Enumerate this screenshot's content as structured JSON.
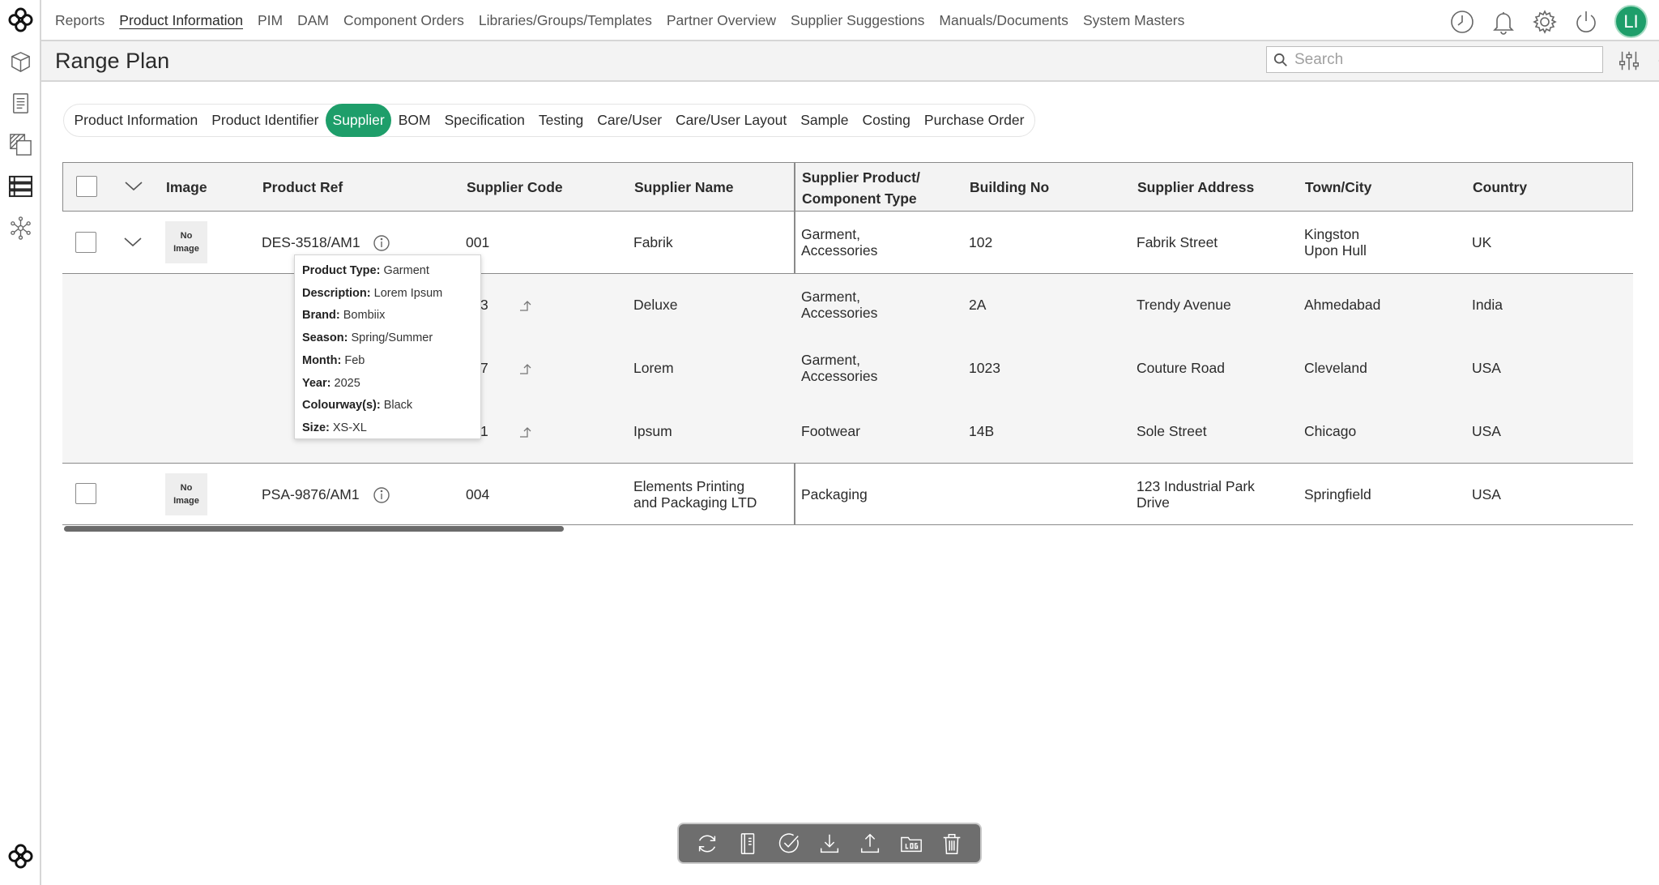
{
  "nav": {
    "items": [
      "Reports",
      "Product Information",
      "PIM",
      "DAM",
      "Component Orders",
      "Libraries/Groups/Templates",
      "Partner Overview",
      "Supplier Suggestions",
      "Manuals/Documents",
      "System Masters"
    ],
    "active_index": 1,
    "avatar_initials": "LI"
  },
  "page": {
    "title": "Range Plan",
    "search_placeholder": "Search"
  },
  "tabs": {
    "items": [
      "Product Information",
      "Product Identifier",
      "Supplier",
      "BOM",
      "Specification",
      "Testing",
      "Care/User",
      "Care/User Layout",
      "Sample",
      "Costing",
      "Purchase Order"
    ],
    "active_index": 2
  },
  "table": {
    "headers": {
      "image": "Image",
      "product_ref": "Product Ref",
      "supplier_code": "Supplier Code",
      "supplier_name": "Supplier Name",
      "supplier_type_l1": "Supplier Product/",
      "supplier_type_l2": "Component Type",
      "building_no": "Building No",
      "supplier_address": "Supplier Address",
      "town_city": "Town/City",
      "country": "Country"
    },
    "no_image_l1": "No",
    "no_image_l2": "Image",
    "rows": [
      {
        "product_ref": "DES-3518/AM1",
        "supplier_code": "001",
        "supplier_name": "Fabrik",
        "type_l1": "Garment,",
        "type_l2": "Accessories",
        "building_no": "102",
        "address": "Fabrik Street",
        "town_l1": "Kingston",
        "town_l2": "Upon Hull",
        "country": "UK"
      },
      {
        "product_ref": "PSA-9876/AM1",
        "supplier_code": "004",
        "supplier_name_l1": "Elements Printing",
        "supplier_name_l2": "and Packaging LTD",
        "type": "Packaging",
        "building_no": "",
        "address_l1": "123 Industrial Park",
        "address_l2": "Drive",
        "town": "Springfield",
        "country": "USA"
      }
    ],
    "sub_rows": [
      {
        "supplier_code": "3",
        "supplier_name": "Deluxe",
        "type_l1": "Garment,",
        "type_l2": "Accessories",
        "building_no": "2A",
        "address": "Trendy Avenue",
        "town": "Ahmedabad",
        "country": "India"
      },
      {
        "supplier_code": "7",
        "supplier_name": "Lorem",
        "type_l1": "Garment,",
        "type_l2": "Accessories",
        "building_no": "1023",
        "address": "Couture Road",
        "town": "Cleveland",
        "country": "USA"
      },
      {
        "supplier_code": "1",
        "supplier_name": "Ipsum",
        "type": "Footwear",
        "building_no": "14B",
        "address": "Sole Street",
        "town": "Chicago",
        "country": "USA"
      }
    ]
  },
  "tooltip": {
    "lines": [
      {
        "label": "Product Type:",
        "value": "Garment"
      },
      {
        "label": "Description:",
        "value": "Lorem Ipsum"
      },
      {
        "label": "Brand:",
        "value": "Bombiix"
      },
      {
        "label": "Season:",
        "value": "Spring/Summer"
      },
      {
        "label": "Month:",
        "value": "Feb"
      },
      {
        "label": "Year:",
        "value": "2025"
      },
      {
        "label": "Colourway(s):",
        "value": "Black"
      },
      {
        "label": "Size:",
        "value": "XS-XL"
      }
    ]
  },
  "colors": {
    "accent": "#1e9e6a",
    "toolbar": "#6e6e6e"
  },
  "icons": {
    "rail": [
      "logo-icon",
      "cube-icon",
      "document-list-icon",
      "layers-icon",
      "list-view-icon",
      "network-icon",
      "logo-icon"
    ],
    "topbar": [
      "clock-icon",
      "bell-icon",
      "gear-icon",
      "power-icon"
    ],
    "titlebar": [
      "sliders-icon",
      "settings-badge-icon"
    ],
    "toolbar": [
      "refresh-icon",
      "notebook-icon",
      "check-circle-icon",
      "download-icon",
      "upload-icon",
      "log-folder-icon",
      "trash-icon"
    ]
  }
}
